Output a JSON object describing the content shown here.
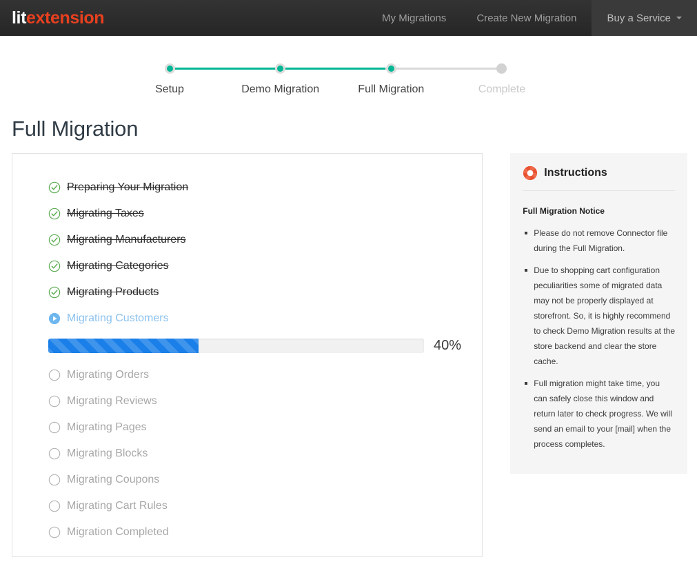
{
  "navbar": {
    "brand_lit": "lit",
    "brand_ext": "extension",
    "items": [
      {
        "label": "My Migrations",
        "active": false
      },
      {
        "label": "Create New Migration",
        "active": false
      },
      {
        "label": "Buy a Service",
        "active": true,
        "has_caret": true
      }
    ]
  },
  "stepper": {
    "steps": [
      {
        "label": "Setup",
        "state": "done"
      },
      {
        "label": "Demo Migration",
        "state": "done"
      },
      {
        "label": "Full Migration",
        "state": "current"
      },
      {
        "label": "Complete",
        "state": "pending"
      }
    ],
    "active_color": "#00b694",
    "pending_color": "#d2d2d2"
  },
  "page": {
    "title": "Full Migration"
  },
  "tasks": [
    {
      "label": "Preparing Your Migration",
      "state": "done"
    },
    {
      "label": "Migrating Taxes",
      "state": "done"
    },
    {
      "label": "Migrating Manufacturers",
      "state": "done"
    },
    {
      "label": "Migrating Categories",
      "state": "done"
    },
    {
      "label": "Migrating Products",
      "state": "done"
    },
    {
      "label": "Migrating Customers",
      "state": "active"
    },
    {
      "label": "Migrating Orders",
      "state": "pending"
    },
    {
      "label": "Migrating Reviews",
      "state": "pending"
    },
    {
      "label": "Migrating Pages",
      "state": "pending"
    },
    {
      "label": "Migrating Blocks",
      "state": "pending"
    },
    {
      "label": "Migrating Coupons",
      "state": "pending"
    },
    {
      "label": "Migrating Cart Rules",
      "state": "pending"
    },
    {
      "label": "Migration Completed",
      "state": "pending"
    }
  ],
  "progress": {
    "percent": 40,
    "percent_label": "40%",
    "fill_color": "#1a7fe8",
    "track_color": "#f1f1f1"
  },
  "instructions": {
    "icon": "lifebuoy-icon",
    "title": "Instructions",
    "subtitle": "Full Migration Notice",
    "bullets": [
      "Please do not remove Connector file during the Full Migration.",
      "Due to shopping cart configuration peculiarities some of migrated data may not be properly displayed at storefront. So, it is highly recommend to check Demo Migration results at the store backend and clear the store cache.",
      "Full migration might take time, you can safely close this window and return later to check progress. We will send an email to your [mail] when the process completes."
    ]
  }
}
